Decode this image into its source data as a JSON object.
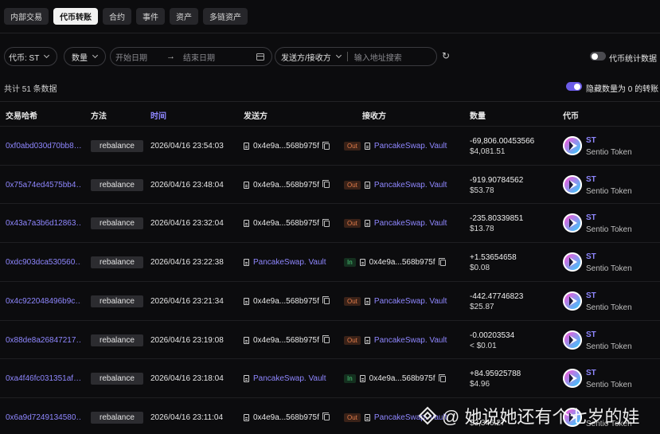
{
  "tabs": [
    "内部交易",
    "代币转账",
    "合约",
    "事件",
    "资产",
    "多链资产"
  ],
  "active_tab": "代币转账",
  "filters": {
    "token": "代币: ST",
    "amount": "数量",
    "start_date_placeholder": "开始日期",
    "end_date_placeholder": "结束日期",
    "party": "发送方/接收方",
    "address_placeholder": "输入地址搜索",
    "stats_label": "代币统计数据",
    "hide_zero_label": "隐藏数量为 0 的转账"
  },
  "total_text": "共计 51 条数据",
  "columns": [
    "交易哈希",
    "方法",
    "时间",
    "发送方",
    "接收方",
    "数量",
    "代币"
  ],
  "rows": [
    {
      "hash": "0xf0abd030d70bb8…",
      "method": "rebalance",
      "time": "2026/04/16 23:54:03",
      "from": "0x4e9a...568b975f",
      "from_type": "addr",
      "dir": "Out",
      "to": "PancakeSwap. Vault",
      "to_type": "vault",
      "amount": "-69,806.00453566",
      "usd": "$4,081.51",
      "symbol": "ST",
      "token_name": "Sentio Token"
    },
    {
      "hash": "0x75a74ed4575bb4…",
      "method": "rebalance",
      "time": "2026/04/16 23:48:04",
      "from": "0x4e9a...568b975f",
      "from_type": "addr",
      "dir": "Out",
      "to": "PancakeSwap. Vault",
      "to_type": "vault",
      "amount": "-919.90784562",
      "usd": "$53.78",
      "symbol": "ST",
      "token_name": "Sentio Token"
    },
    {
      "hash": "0x43a7a3b6d12863…",
      "method": "rebalance",
      "time": "2026/04/16 23:32:04",
      "from": "0x4e9a...568b975f",
      "from_type": "addr",
      "dir": "Out",
      "to": "PancakeSwap. Vault",
      "to_type": "vault",
      "amount": "-235.80339851",
      "usd": "$13.78",
      "symbol": "ST",
      "token_name": "Sentio Token"
    },
    {
      "hash": "0xdc903dca530560…",
      "method": "rebalance",
      "time": "2026/04/16 23:22:38",
      "from": "PancakeSwap. Vault",
      "from_type": "vault",
      "dir": "In",
      "to": "0x4e9a...568b975f",
      "to_type": "addr",
      "amount": "+1.53654658",
      "usd": "$0.08",
      "symbol": "ST",
      "token_name": "Sentio Token"
    },
    {
      "hash": "0x4c922048496b9c…",
      "method": "rebalance",
      "time": "2026/04/16 23:21:34",
      "from": "0x4e9a...568b975f",
      "from_type": "addr",
      "dir": "Out",
      "to": "PancakeSwap. Vault",
      "to_type": "vault",
      "amount": "-442.47746823",
      "usd": "$25.87",
      "symbol": "ST",
      "token_name": "Sentio Token"
    },
    {
      "hash": "0x88de8a26847217…",
      "method": "rebalance",
      "time": "2026/04/16 23:19:08",
      "from": "0x4e9a...568b975f",
      "from_type": "addr",
      "dir": "Out",
      "to": "PancakeSwap. Vault",
      "to_type": "vault",
      "amount": "-0.00203534",
      "usd": "< $0.01",
      "symbol": "ST",
      "token_name": "Sentio Token"
    },
    {
      "hash": "0xa4f46fc031351af…",
      "method": "rebalance",
      "time": "2026/04/16 23:18:04",
      "from": "PancakeSwap. Vault",
      "from_type": "vault",
      "dir": "In",
      "to": "0x4e9a...568b975f",
      "to_type": "addr",
      "amount": "+84.95925788",
      "usd": "$4.96",
      "symbol": "ST",
      "token_name": "Sentio Token"
    },
    {
      "hash": "0x6a9d7249134580…",
      "method": "rebalance",
      "time": "2026/04/16 23:11:04",
      "from": "0x4e9a...568b975f",
      "from_type": "addr",
      "dir": "Out",
      "to": "PancakeSwap. Vault",
      "to_type": "vault",
      "amount": "",
      "usd": "$3,346.27",
      "symbol": "",
      "token_name": "Sentio Token"
    }
  ],
  "watermark": "@ 她说她还有个七岁的娃",
  "colors": {
    "accent": "#8f87ff",
    "out": "#e07b4a",
    "in": "#4fcf7c",
    "toggle_on": "#6c5ce7"
  }
}
